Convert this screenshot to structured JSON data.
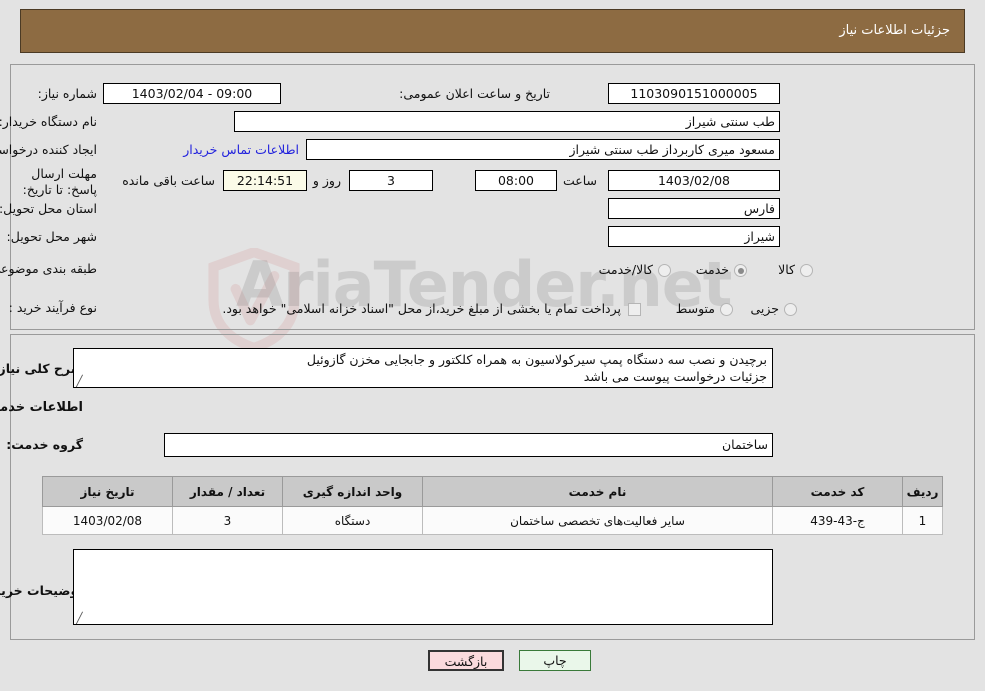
{
  "header": {
    "title": "جزئیات اطلاعات نیاز"
  },
  "watermark": {
    "text": "AriaTender.net",
    "shield_color": "#d9a7a7"
  },
  "top_form": {
    "need_number_label": "شماره نیاز:",
    "need_number_value": "1103090151000005",
    "announce_datetime_label": "تاریخ و ساعت اعلان عمومی:",
    "announce_datetime_value": "09:00 - 1403/02/04",
    "buyer_org_label": "نام دستگاه خریدار:",
    "buyer_org_value": "طب سنتی شیراز",
    "creator_label": "ایجاد کننده درخواست:",
    "creator_value": "مسعود میری کاربرداز طب سنتی شیراز",
    "contact_link": "اطلاعات تماس خریدار",
    "deadline_label": "مهلت ارسال پاسخ: تا تاریخ:",
    "deadline_date": "1403/02/08",
    "hour_label": "ساعت",
    "deadline_time": "08:00",
    "days_value": "3",
    "days_label": "روز و",
    "countdown_value": "22:14:51",
    "remaining_label": "ساعت باقی مانده",
    "province_label": "استان محل تحویل:",
    "province_value": "فارس",
    "city_label": "شهر محل تحویل:",
    "city_value": "شیراز",
    "category_label": "طبقه بندی موضوعی:",
    "category_options": [
      {
        "label": "کالا",
        "selected": false
      },
      {
        "label": "خدمت",
        "selected": true
      },
      {
        "label": "کالا/خدمت",
        "selected": false
      }
    ],
    "process_label": "نوع فرآیند خرید :",
    "process_options": [
      {
        "label": "جزیی",
        "selected": true
      },
      {
        "label": "متوسط",
        "selected": false
      }
    ],
    "treasury_checkbox_label": "پرداخت تمام یا بخشی از مبلغ خرید،از محل \"اسناد خزانه اسلامی\" خواهد بود.",
    "treasury_checked": false
  },
  "middle": {
    "general_desc_label": "شرح کلی نیاز:",
    "general_desc_value": "برچیدن و نصب سه دستگاه پمپ سیرکولاسیون به همراه کلکتور و جابجایی مخزن گازوئیل\nجزئیات درخواست پیوست می باشد",
    "section_title": "اطلاعات خدمات مورد نیاز",
    "service_group_label": "گروه خدمت:",
    "service_group_value": "ساختمان",
    "buyer_notes_label": "توضیحات خریدار:",
    "buyer_notes_value": ""
  },
  "table": {
    "columns": [
      "ردیف",
      "کد خدمت",
      "نام خدمت",
      "واحد اندازه گیری",
      "تعداد / مقدار",
      "تاریخ نیاز"
    ],
    "rows": [
      {
        "radif": "1",
        "code": "ج-43-439",
        "name": "سایر فعالیت‌های تخصصی ساختمان",
        "unit": "دستگاه",
        "qty": "3",
        "date": "1403/02/08"
      }
    ]
  },
  "footer": {
    "back_label": "بازگشت",
    "print_label": "چاپ"
  }
}
